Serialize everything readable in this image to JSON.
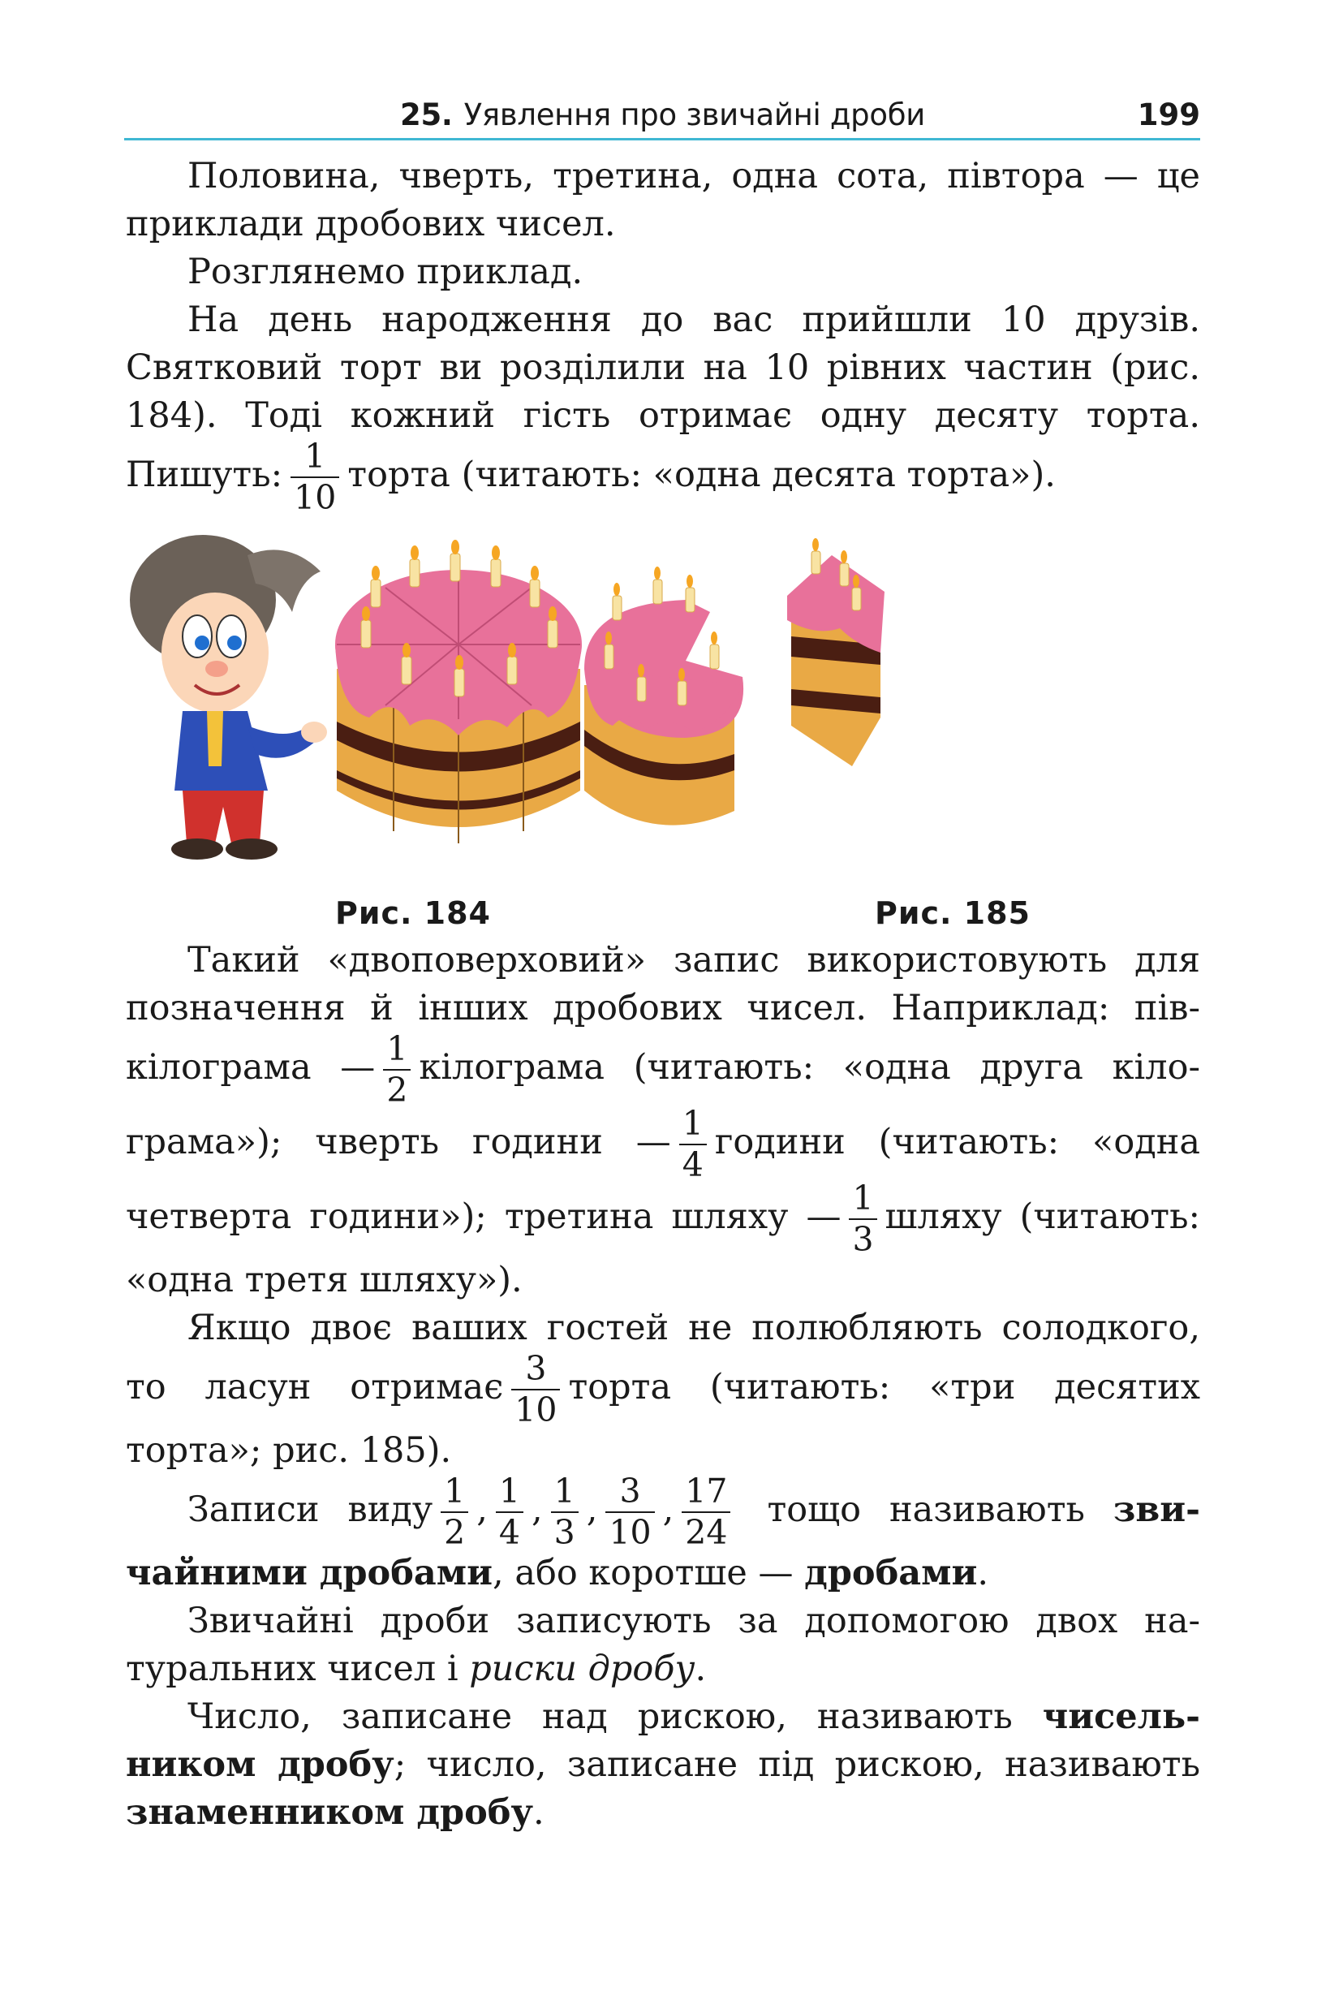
{
  "header": {
    "section_number": "25.",
    "section_title": "Уявлення про звичайні дроби",
    "page_number": "199"
  },
  "p1": {
    "text": "Половина, чверть, третина, одна сота, півтора — це приклади дробових чисел."
  },
  "p2": {
    "text": "Розглянемо приклад."
  },
  "p3": {
    "text_a": "На день народження до вас прийшли 10 друзів. Святковий торт ви розділили на 10 рівних частин (рис. 184). Тоді кожний гість отримає одну десяту торта. Пишуть:",
    "frac_num": "1",
    "frac_den": "10",
    "text_b": "торта (читають: «одна десята торта»)."
  },
  "figures": {
    "caption_184": "Рис. 184",
    "caption_185": "Рис. 185"
  },
  "p4": {
    "text_a": "Такий «двоповерховий» запис використовують для позначення й інших дробових чисел. Наприклад: пів­кілограма —",
    "f1_num": "1",
    "f1_den": "2",
    "text_b": "кілограма (читають: «одна друга кіло­грама»); чверть години —",
    "f2_num": "1",
    "f2_den": "4",
    "text_c": "години (читають: «одна четверта години»); третина шляху —",
    "f3_num": "1",
    "f3_den": "3",
    "text_d": "шляху (чита­ють: «одна третя шляху»)."
  },
  "p5": {
    "text_a": "Якщо двоє ваших гостей не полюбляють солодкого, то ласун отримає",
    "frac_num": "3",
    "frac_den": "10",
    "text_b": "торта (читають: «три десятих торта»; рис. 185)."
  },
  "p6": {
    "text_a": "Записи виду",
    "fractions": [
      {
        "num": "1",
        "den": "2"
      },
      {
        "num": "1",
        "den": "4"
      },
      {
        "num": "1",
        "den": "3"
      },
      {
        "num": "3",
        "den": "10"
      },
      {
        "num": "17",
        "den": "24"
      }
    ],
    "sep": ",",
    "text_b": "тощо називають",
    "bold_a": "зви­чайними дробами",
    "text_c": ", або коротше —",
    "bold_b": "дробами",
    "text_d": "."
  },
  "p7": {
    "text_a": "Звичайні дроби записують за допомогою двох на­туральних чисел і",
    "italic": "риски дробу",
    "text_b": "."
  },
  "p8": {
    "text_a": "Число, записане над рискою, називають",
    "bold_a": "чисель­ником дробу",
    "text_b": "; число, записане під рискою, називають",
    "bold_b": "знаменником дробу",
    "text_c": "."
  },
  "colors": {
    "header_rule": "#3fb7d3",
    "icing": "#e8719a",
    "sponge": "#e9a945",
    "chocolate": "#4a1e12"
  }
}
